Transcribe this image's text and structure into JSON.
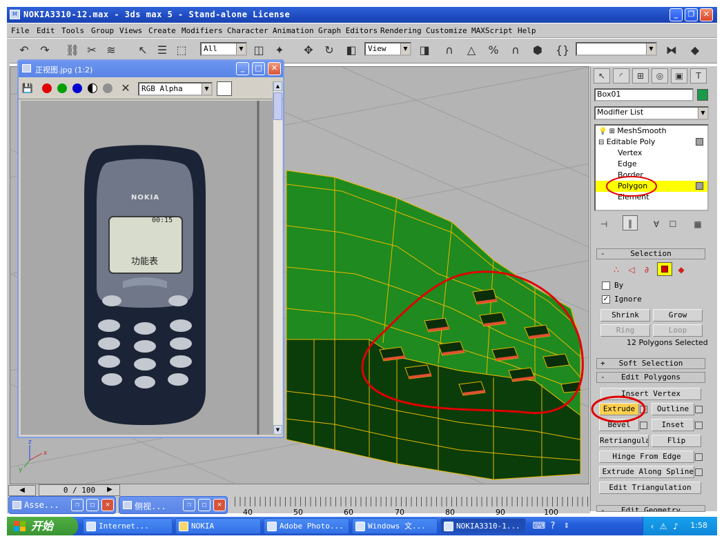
{
  "window": {
    "title": "NOKIA3310-12.max - 3ds max 5 - Stand-alone License"
  },
  "menu": [
    "File",
    "Edit",
    "Tools",
    "Group",
    "Views",
    "Create",
    "Modifiers",
    "Character",
    "Animation",
    "Graph Editors",
    "Rendering",
    "Customize",
    "MAXScript",
    "Help"
  ],
  "toolbar": {
    "selection_filter": "All",
    "reference_coord": "View"
  },
  "image_viewer": {
    "title": "正视图.jpg (1:2)",
    "channel_select": "RGB Alpha",
    "photo": {
      "brand": "NOKIA",
      "screen_time": "00:15",
      "screen_text": "功能表"
    }
  },
  "command_panel": {
    "object_name": "Box01",
    "object_color": "#1a9a4a",
    "modifier_list": "Modifier List",
    "stack": [
      {
        "label": "MeshSmooth",
        "level": 0
      },
      {
        "label": "Editable Poly",
        "level": 0
      },
      {
        "label": "Vertex",
        "level": 1
      },
      {
        "label": "Edge",
        "level": 1
      },
      {
        "label": "Border",
        "level": 1
      },
      {
        "label": "Polygon",
        "level": 1,
        "selected": true
      },
      {
        "label": "Element",
        "level": 1
      }
    ],
    "selection_rollout": {
      "title": "Selection",
      "by_label": "By",
      "ignore_label": "Ignore",
      "shrink": "Shrink",
      "grow": "Grow",
      "ring": "Ring",
      "loop": "Loop",
      "status": "12 Polygons Selected"
    },
    "soft_selection": "Soft Selection",
    "edit_polygons": {
      "title": "Edit Polygons",
      "insert_vertex": "Insert Vertex",
      "extrude": "Extrude",
      "outline": "Outline",
      "bevel": "Bevel",
      "inset": "Inset",
      "retriangulate": "Retriangulate",
      "flip": "Flip",
      "hinge_from_edge": "Hinge From Edge",
      "extrude_along_spline": "Extrude Along Spline",
      "edit_triangulation": "Edit Triangulation"
    },
    "edit_geometry": "Edit Geometry"
  },
  "timeline": {
    "slider": "0 / 100",
    "ticks": [
      "40",
      "50",
      "60",
      "70",
      "80",
      "90",
      "100"
    ]
  },
  "minimized_windows": [
    "Asse...",
    "侧视..."
  ],
  "taskbar": {
    "start": "开始",
    "items": [
      "Internet...",
      "NOKIA",
      "Adobe Photo...",
      "Windows 文...",
      "NOKIA3310-1..."
    ],
    "clock": "1:58"
  },
  "colors": {
    "mesh_green": "#1f8a1f",
    "edge_yellow": "#e8b800",
    "annotation_red": "#e00000",
    "selected_yellow": "#ffff00"
  }
}
